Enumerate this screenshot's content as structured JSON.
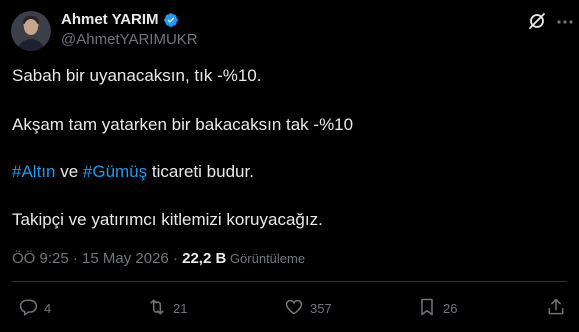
{
  "author": {
    "display_name": "Ahmet YARIM",
    "handle": "@AhmetYARIMUKR",
    "verified": true
  },
  "tweet": {
    "line1": "Sabah bir uyanacaksın, tık -%10.",
    "line2": "Akşam tam yatarken bir bakacaksın tak -%10",
    "line3": {
      "hashtag1": "#Altın",
      "connector": " ve ",
      "hashtag2": "#Gümüş",
      "rest": " ticareti budur."
    },
    "line4": "Takipçi ve yatırımcı kitlemizi koruyacağız."
  },
  "meta": {
    "time": "ÖÖ 9:25",
    "separator1": " · ",
    "date": "15 May 2026",
    "separator2": " · ",
    "views_count": "22,2 B",
    "views_label": " Görüntüleme"
  },
  "actions": {
    "replies": "4",
    "retweets": "21",
    "likes": "357",
    "bookmarks": "26"
  },
  "colors": {
    "background": "#000000",
    "text": "#e7e9ea",
    "muted": "#71767b",
    "accent": "#1d9bf0"
  },
  "icons": [
    "verified-badge-icon",
    "grok-icon",
    "more-icon",
    "reply-icon",
    "retweet-icon",
    "like-icon",
    "bookmark-icon",
    "share-icon"
  ]
}
